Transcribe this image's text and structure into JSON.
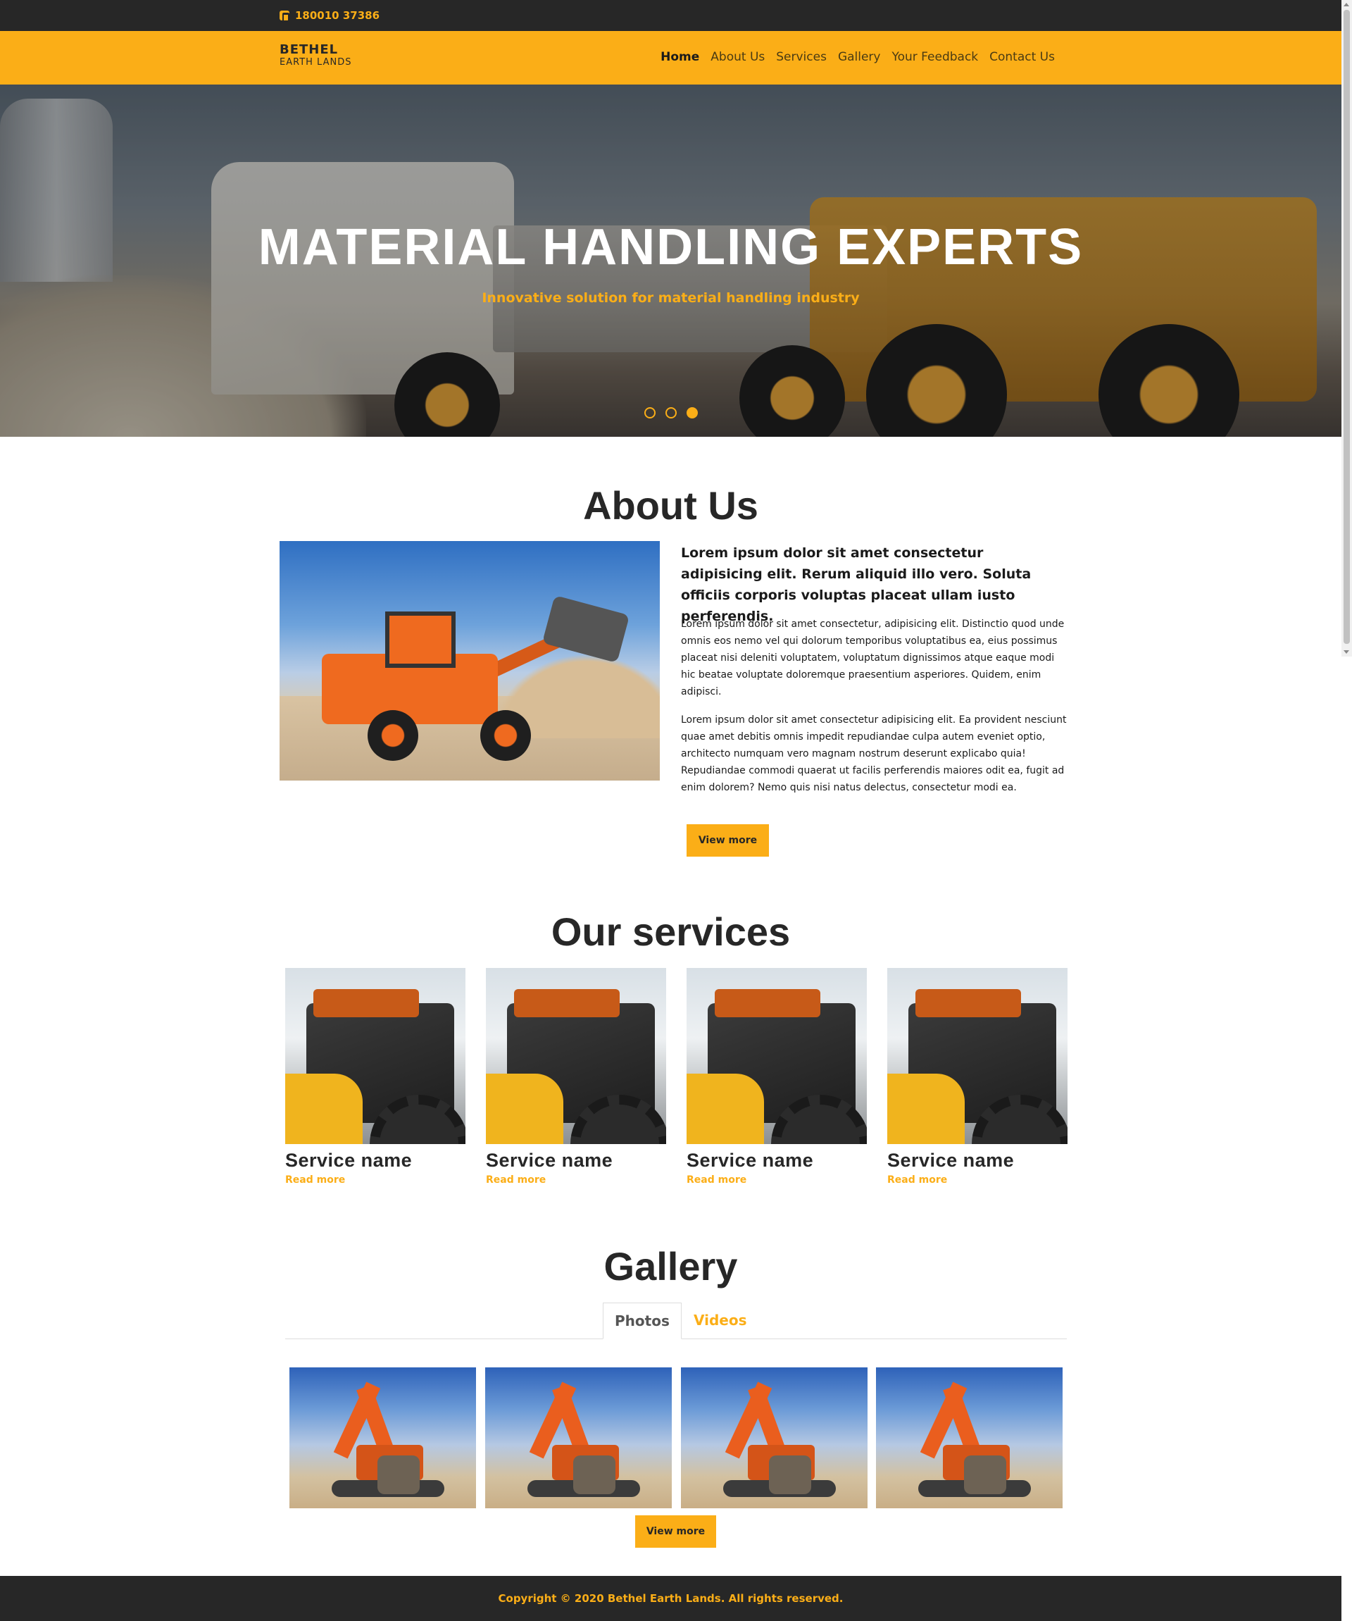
{
  "topbar": {
    "phone": "180010 37386",
    "phone_icon": "phone-icon"
  },
  "brand": {
    "line1": "BETHEL",
    "line2": "EARTH LANDS"
  },
  "nav": {
    "items": [
      "Home",
      "About Us",
      "Services",
      "Gallery",
      "Your Feedback",
      "Contact Us"
    ],
    "active": "Home"
  },
  "hero": {
    "title": "MATERIAL HANDLING EXPERTS",
    "subtitle": "Innovative solution for material handling industry",
    "slides": 3,
    "active_slide": 3
  },
  "about": {
    "title": "About Us",
    "lead": "Lorem ipsum dolor sit amet consectetur adipisicing elit. Rerum aliquid illo vero. Soluta officiis corporis voluptas placeat ullam iusto perferendis.",
    "p1": "Lorem ipsum dolor sit amet consectetur, adipisicing elit. Distinctio quod unde omnis eos nemo vel qui dolorum temporibus voluptatibus ea, eius possimus placeat nisi deleniti voluptatem, voluptatum dignissimos atque eaque modi hic beatae voluptate doloremque praesentium asperiores. Quidem, enim adipisci.",
    "p2": "Lorem ipsum dolor sit amet consectetur adipisicing elit. Ea provident nesciunt quae amet debitis omnis impedit repudiandae culpa autem eveniet optio, architecto numquam vero magnam nostrum deserunt explicabo quia! Repudiandae commodi quaerat ut facilis perferendis maiores odit ea, fugit ad enim dolorem? Nemo quis nisi natus delectus, consectetur modi ea.",
    "button": "View more"
  },
  "services": {
    "title": "Our services",
    "items": [
      {
        "name": "Service name",
        "link": "Read more"
      },
      {
        "name": "Service name",
        "link": "Read more"
      },
      {
        "name": "Service name",
        "link": "Read more"
      },
      {
        "name": "Service name",
        "link": "Read more"
      }
    ]
  },
  "gallery": {
    "title": "Gallery",
    "tabs": [
      "Photos",
      "Videos"
    ],
    "active_tab": "Photos",
    "photo_count": 4,
    "button": "View more"
  },
  "footer": {
    "copyright": "Copyright © 2020 Bethel Earth Lands. All rights reserved."
  },
  "colors": {
    "accent": "#fbae17",
    "dark": "#272727",
    "white": "#ffffff"
  }
}
